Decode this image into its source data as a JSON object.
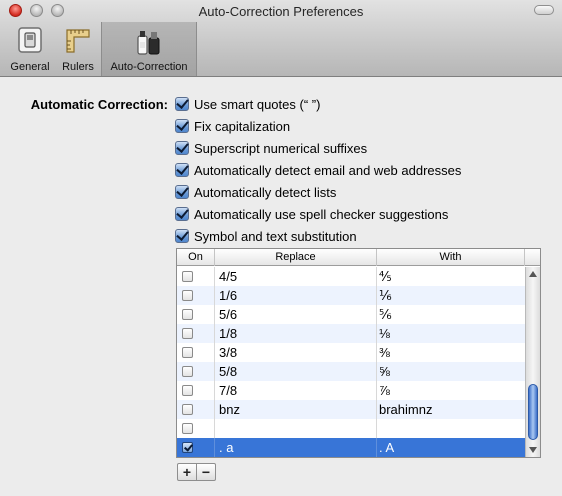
{
  "window": {
    "title": "Auto-Correction Preferences"
  },
  "toolbar": {
    "items": [
      {
        "label": "General",
        "icon": "general-switch-icon"
      },
      {
        "label": "Rulers",
        "icon": "ruler-icon"
      },
      {
        "label": "Auto-Correction",
        "icon": "auto-correction-bottles-icon",
        "selected": true
      }
    ]
  },
  "section": {
    "label": "Automatic Correction:"
  },
  "options": [
    {
      "label": "Use smart quotes (“ ”)",
      "checked": true
    },
    {
      "label": "Fix capitalization",
      "checked": true
    },
    {
      "label": "Superscript numerical suffixes",
      "checked": true
    },
    {
      "label": "Automatically detect email and web addresses",
      "checked": true
    },
    {
      "label": "Automatically detect lists",
      "checked": true
    },
    {
      "label": "Automatically use spell checker suggestions",
      "checked": true
    },
    {
      "label": "Symbol and text substitution",
      "checked": true
    }
  ],
  "table": {
    "headers": {
      "on": "On",
      "replace": "Replace",
      "with": "With"
    },
    "rows": [
      {
        "on": false,
        "replace": "4/5",
        "with": "⅘"
      },
      {
        "on": false,
        "replace": "1/6",
        "with": "⅙"
      },
      {
        "on": false,
        "replace": "5/6",
        "with": "⅚"
      },
      {
        "on": false,
        "replace": "1/8",
        "with": "⅛"
      },
      {
        "on": false,
        "replace": "3/8",
        "with": "⅜"
      },
      {
        "on": false,
        "replace": "5/8",
        "with": "⅝"
      },
      {
        "on": false,
        "replace": "7/8",
        "with": "⅞"
      },
      {
        "on": false,
        "replace": "bnz",
        "with": "brahimnz"
      },
      {
        "on": false,
        "replace": "",
        "with": ""
      },
      {
        "on": true,
        "replace": ". a",
        "with": ". A",
        "selected": true
      }
    ]
  },
  "buttons": {
    "add": "+",
    "remove": "−"
  },
  "colors": {
    "selection": "#3875d7",
    "alt_row": "#edf3fe",
    "checkbox_blue": "#4f86cd"
  }
}
